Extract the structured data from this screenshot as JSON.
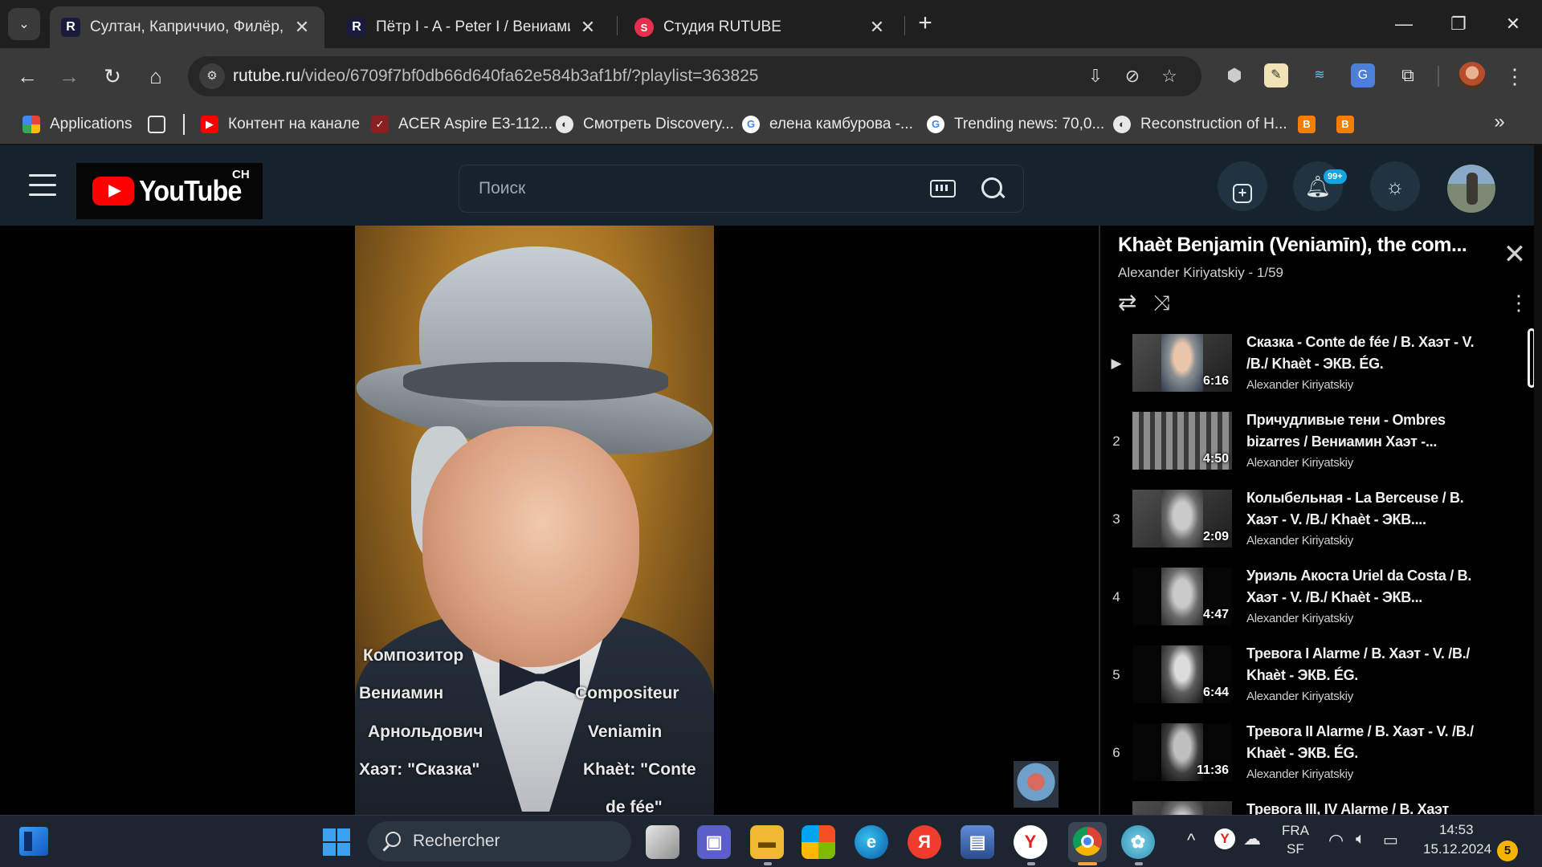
{
  "browser": {
    "tabs": [
      {
        "title": "Султан, Каприччио, Филёр, Та",
        "favicon": "R",
        "active": true
      },
      {
        "title": "Пётр I - A - Peter I / Вениамин",
        "favicon": "R",
        "active": false
      },
      {
        "title": "Студия RUTUBE",
        "favicon": "S",
        "active": false
      }
    ],
    "window_controls": {
      "minimize": "—",
      "restore": "❐",
      "close": "✕"
    },
    "url_host": "rutube.ru",
    "url_path": "/video/6709f7bf0db66d640fa62e584b3af1bf/?playlist=363825",
    "bookmarks": [
      {
        "label": "Applications",
        "icon": "apps-grid-icon"
      },
      {
        "label": "Контент на канале",
        "icon": "youtube-icon"
      },
      {
        "label": "ACER Aspire E3-112...",
        "icon": "acer-icon"
      },
      {
        "label": "Смотреть Discovery...",
        "icon": "globe-icon"
      },
      {
        "label": "елена камбурова -...",
        "icon": "google-icon"
      },
      {
        "label": "Trending news: 70,0...",
        "icon": "google-icon"
      },
      {
        "label": "Reconstruction of H...",
        "icon": "globe-icon"
      }
    ],
    "bookmark_overflow": "»"
  },
  "site": {
    "channel_logo_text": "YouTube",
    "channel_logo_suffix": "CH",
    "search_placeholder": "Поиск",
    "notification_badge": "99+"
  },
  "video": {
    "caption_ru": [
      "Композитор",
      "Вениамин",
      "Арнольдович",
      "Хаэт: \"Сказка\""
    ],
    "caption_fr": [
      "Compositeur",
      "Veniamin",
      "Khaèt: \"Conte",
      "de fée\""
    ]
  },
  "playlist": {
    "title": "Khaèt Benjamin (Veniamīn), the com...",
    "subtitle": "Alexander Kiriyatskiy - 1/59",
    "close_glyph": "✕",
    "items": [
      {
        "index": "▶",
        "title": "Сказка - Conte de fée / В. Хаэт - V. /B./ Khaèt - ЭКВ. ÉG.",
        "author": "Alexander Kiriyatskiy",
        "duration": "6:16"
      },
      {
        "index": "2",
        "title": "Причудливые тени - Ombres bizarres / Вениамин Хаэт -...",
        "author": "Alexander Kiriyatskiy",
        "duration": "4:50"
      },
      {
        "index": "3",
        "title": "Колыбельная - La Berceuse / В. Хаэт - V. /B./ Khaèt - ЭКВ....",
        "author": "Alexander Kiriyatskiy",
        "duration": "2:09"
      },
      {
        "index": "4",
        "title": "Уриэль Акоста Uriel da Costa / В. Хаэт - V. /B./ Khaèt - ЭКВ...",
        "author": "Alexander Kiriyatskiy",
        "duration": "4:47"
      },
      {
        "index": "5",
        "title": "Тревога I Alarme / В. Хаэт - V. /B./ Khaèt - ЭКВ. ÉG.",
        "author": "Alexander Kiriyatskiy",
        "duration": "6:44"
      },
      {
        "index": "6",
        "title": "Тревога II Alarme / В. Хаэт - V. /B./ Khaèt - ЭКВ. ÉG.",
        "author": "Alexander Kiriyatskiy",
        "duration": "11:36"
      },
      {
        "index": "7",
        "title": "Тревога III, IV Alarme / В. Хаэт",
        "author": "",
        "duration": ""
      }
    ]
  },
  "taskbar": {
    "search_text": "Rechercher",
    "language": "FRA",
    "language_sub": "SF",
    "time": "14:53",
    "date": "15.12.2024",
    "notification_count": "5"
  }
}
